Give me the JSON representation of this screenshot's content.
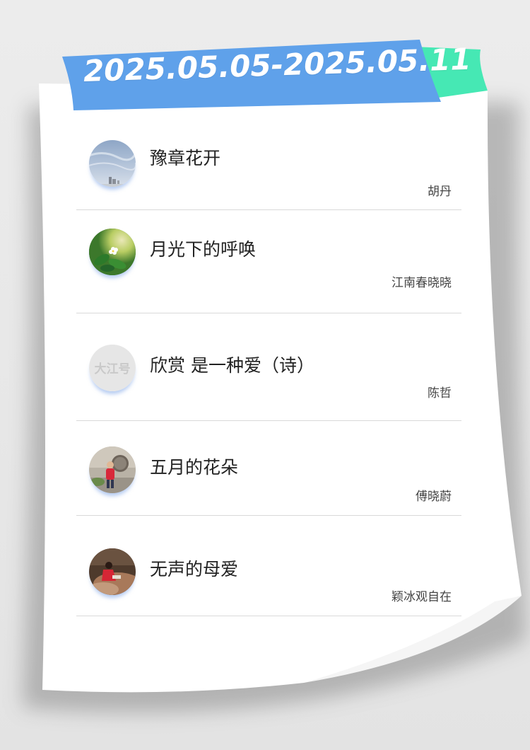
{
  "header": {
    "date_range": "2025.05.05-2025.05.11"
  },
  "colors": {
    "ribbon_blue": "#5fa1ea",
    "ribbon_green": "#46e8b4",
    "paper": "#ffffff",
    "divider": "#d9d9d9"
  },
  "articles": [
    {
      "title": "豫章花开",
      "author": "胡丹",
      "thumbnail": "sky-buildings-photo"
    },
    {
      "title": "月光下的呼唤",
      "author": "江南春晓晓",
      "thumbnail": "green-flower-photo"
    },
    {
      "title": "欣赏 是一种爱（诗）",
      "author": "陈哲",
      "thumbnail": "dajianghao-logo",
      "thumbnail_text": "大江号"
    },
    {
      "title": "五月的花朵",
      "author": "傅晓蔚",
      "thumbnail": "person-red-shirt-photo"
    },
    {
      "title": "无声的母爱",
      "author": "颖冰观自在",
      "thumbnail": "person-sitting-photo"
    }
  ]
}
